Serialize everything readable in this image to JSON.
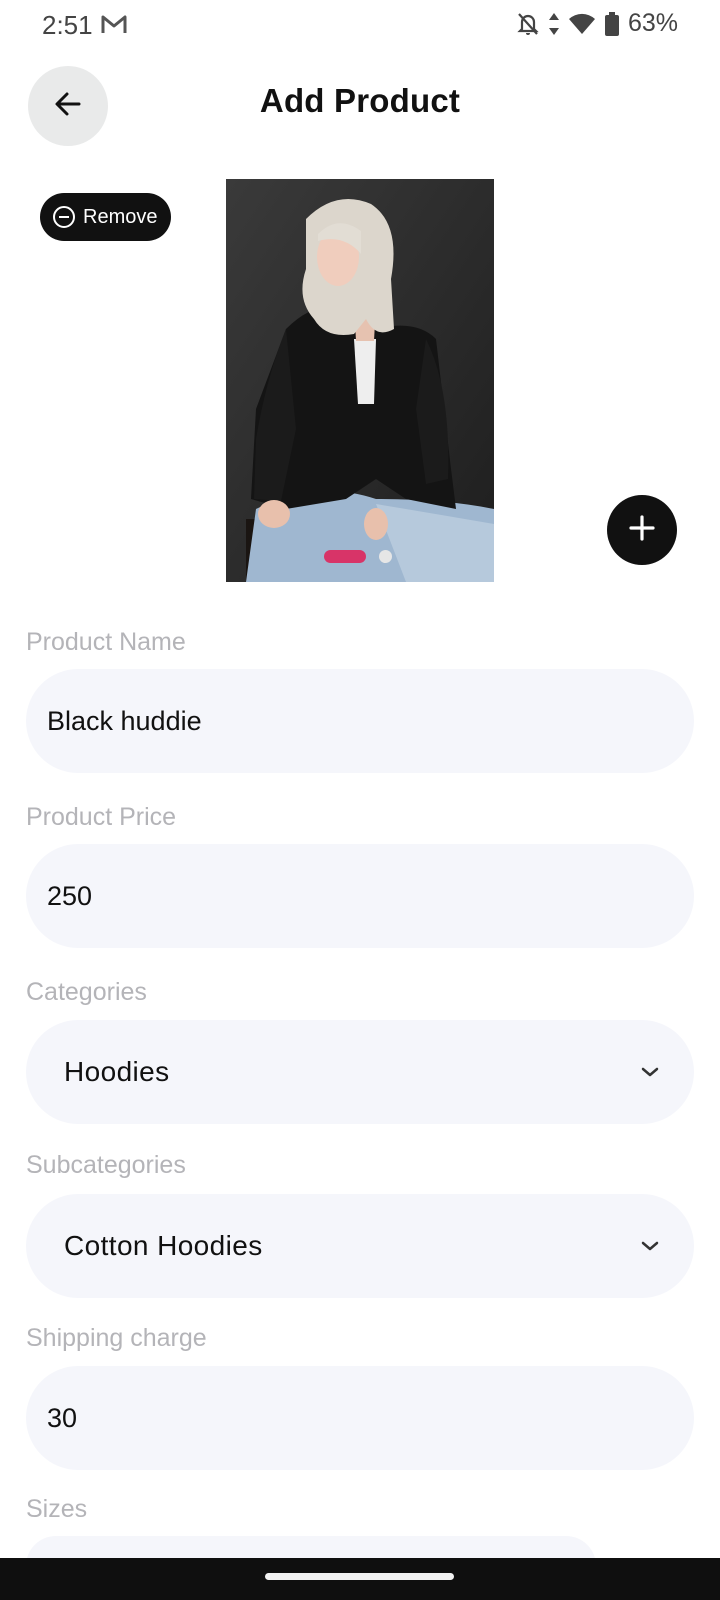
{
  "status_bar": {
    "time": "2:51",
    "battery": "63%",
    "icons": [
      "gmail-icon",
      "bell-off-icon",
      "data-arrows-icon",
      "wifi-icon",
      "battery-icon"
    ]
  },
  "header": {
    "title": "Add Product",
    "back_icon": "arrow-left-icon"
  },
  "image_gallery": {
    "remove_label": "Remove",
    "remove_icon": "minus-circle-icon",
    "add_icon": "plus-icon",
    "current_page": 1,
    "total_pages": 2,
    "active_dot_color": "#d83468"
  },
  "form": {
    "product_name": {
      "label": "Product Name",
      "value": "Black huddie"
    },
    "product_price": {
      "label": "Product Price",
      "value": "250"
    },
    "categories": {
      "label": "Categories",
      "value": "Hoodies"
    },
    "subcategories": {
      "label": "Subcategories",
      "value": "Cotton Hoodies"
    },
    "shipping_charge": {
      "label": "Shipping charge",
      "value": "30"
    },
    "sizes": {
      "label": "Sizes"
    }
  }
}
